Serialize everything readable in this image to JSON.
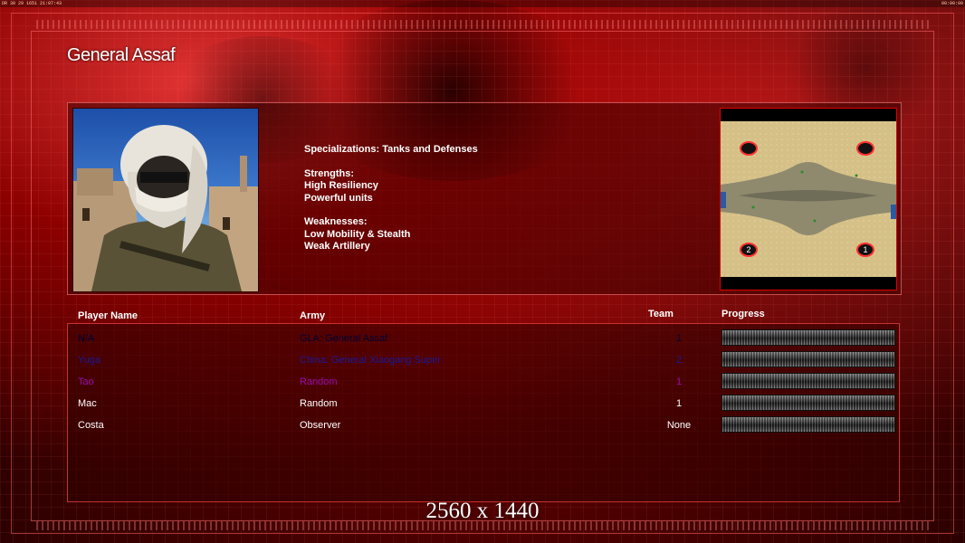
{
  "topbar": {
    "left": "DR 30 29 1651 21:07:43",
    "right": "00:00:00"
  },
  "general": {
    "title": "General Assaf",
    "specializations": "Specializations: Tanks and Defenses",
    "strengths_heading": "Strengths:",
    "strengths": [
      "High Resiliency",
      "Powerful units"
    ],
    "weaknesses_heading": "Weaknesses:",
    "weaknesses": [
      "Low Mobility & Stealth",
      "Weak Artillery"
    ]
  },
  "minimap": {
    "start_positions": [
      "1",
      "2"
    ]
  },
  "table": {
    "headers": {
      "player": "Player Name",
      "army": "Army",
      "team": "Team",
      "progress": "Progress"
    },
    "rows": [
      {
        "name": "N/A",
        "army": "GLA: General Assaf",
        "team": "1",
        "color": "#000033"
      },
      {
        "name": "Yuga",
        "army": "China: General Xiaogang Super",
        "team": "2",
        "color": "#1a1a9a"
      },
      {
        "name": "Tao",
        "army": "Random",
        "team": "1",
        "color": "#9a0ab0"
      },
      {
        "name": "Mac",
        "army": "Random",
        "team": "1",
        "color": "#ffffff"
      },
      {
        "name": "Costa",
        "army": "Observer",
        "team": "None",
        "color": "#ffffff"
      }
    ]
  },
  "resolution_label": "2560 x 1440",
  "colors": {
    "accent": "#ff3030",
    "panel_border": "#ff7070"
  }
}
